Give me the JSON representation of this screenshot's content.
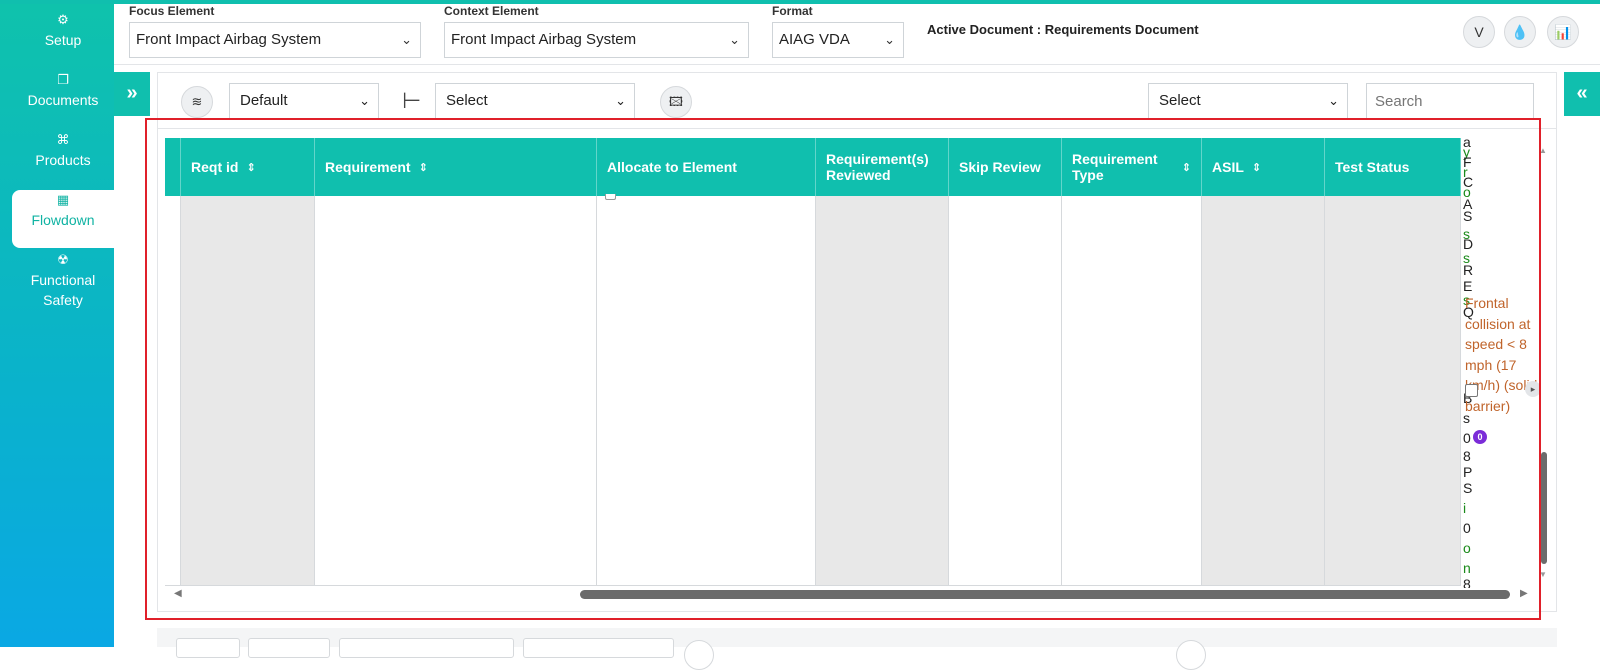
{
  "sidebar": {
    "items": [
      {
        "label": "Setup",
        "icon": "gears-icon",
        "glyph": "⚙"
      },
      {
        "label": "Documents",
        "icon": "documents-icon",
        "glyph": "❐"
      },
      {
        "label": "Products",
        "icon": "products-icon",
        "glyph": "⌘"
      },
      {
        "label": "Flowdown",
        "icon": "building-icon",
        "glyph": "▦"
      },
      {
        "label": "Functional Safety",
        "icon": "radiation-icon",
        "glyph": "☢"
      }
    ],
    "active": "Flowdown",
    "expand_glyph": "»"
  },
  "header": {
    "focus_label": "Focus Element",
    "focus_value": "Front Impact Airbag System",
    "context_label": "Context Element",
    "context_value": "Front Impact Airbag System",
    "format_label": "Format",
    "format_value": "AIAG VDA",
    "active_document": "Active Document : Requirements Document",
    "buttons": [
      {
        "icon": "vcs-icon",
        "glyph": "V"
      },
      {
        "icon": "drop-icon",
        "glyph": "💧"
      },
      {
        "icon": "chart-icon",
        "glyph": "📊"
      }
    ]
  },
  "toolbar": {
    "layers_glyph": "≋",
    "view_select": "Default",
    "flow_glyph": "⊢",
    "select_1": "Select",
    "image_glyph": "🖾",
    "select_2": "Select",
    "search_placeholder": "Search",
    "collapse_glyph": "«"
  },
  "table": {
    "columns": [
      {
        "label": "Reqt id",
        "sortable": true
      },
      {
        "label": "Requirement",
        "sortable": true
      },
      {
        "label": "Allocate to Element",
        "sortable": false
      },
      {
        "label": "Requirement(s) Reviewed",
        "sortable": false
      },
      {
        "label": "Skip Review",
        "sortable": false
      },
      {
        "label": "Requirement Type",
        "sortable": true
      },
      {
        "label": "ASIL",
        "sortable": true
      },
      {
        "label": "Test Status",
        "sortable": false
      }
    ],
    "sort_glyph": "⇕",
    "overflow_black_letters": [
      "a",
      "F",
      "C",
      "A",
      "S",
      "D",
      "R",
      "E",
      "Q",
      "B",
      "s",
      "0",
      "8",
      "P",
      "S",
      "0",
      "8"
    ],
    "overflow_green_letters": [
      "y",
      "r",
      "o",
      "s",
      "s",
      "s",
      "i",
      "o",
      "n"
    ],
    "overflow_brown_text": "Frontal collision at speed < 8 mph (17 km/h) (solid barrier)",
    "badge_count": "0",
    "expand_glyph": "▸"
  },
  "colors": {
    "accent": "#10bfae",
    "highlight": "#e0202a",
    "badge": "#7b2cd8",
    "brown_text": "#c0642b",
    "green_text": "#1a8a1a"
  }
}
